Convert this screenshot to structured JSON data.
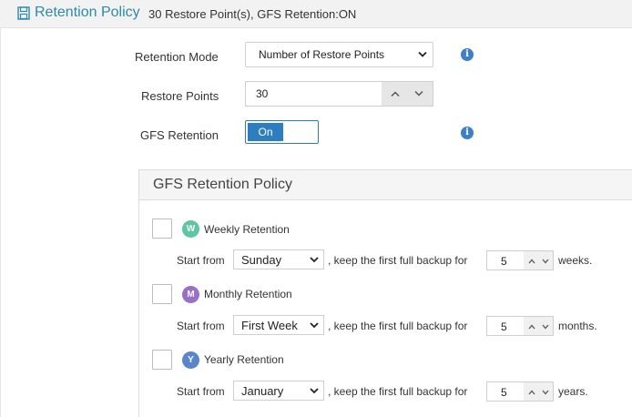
{
  "header": {
    "title": "Retention Policy",
    "summary": "30 Restore Point(s), GFS Retention:ON"
  },
  "form": {
    "retention_mode_label": "Retention Mode",
    "retention_mode_value": "Number of Restore Points",
    "restore_points_label": "Restore Points",
    "restore_points_value": "30",
    "gfs_label": "GFS Retention",
    "gfs_toggle": "On"
  },
  "gfs": {
    "title": "GFS Retention Policy",
    "start_from": "Start from",
    "keep_text": ", keep the first full backup for",
    "rows": [
      {
        "badge": "W",
        "label": "Weekly Retention",
        "start": "Sunday",
        "count": "5",
        "unit": "weeks.",
        "color": "#5fc7a0"
      },
      {
        "badge": "M",
        "label": "Monthly Retention",
        "start": "First Week",
        "count": "5",
        "unit": "months.",
        "color": "#9a6fc7"
      },
      {
        "badge": "Y",
        "label": "Yearly Retention",
        "start": "January",
        "count": "5",
        "unit": "years.",
        "color": "#5a86c8"
      }
    ]
  },
  "icons": [
    "save-icon",
    "info-icon",
    "chevron-down-icon",
    "chevron-up-icon"
  ],
  "colors": {
    "accent": "#2d7ec0",
    "title": "#2e8aa8"
  }
}
